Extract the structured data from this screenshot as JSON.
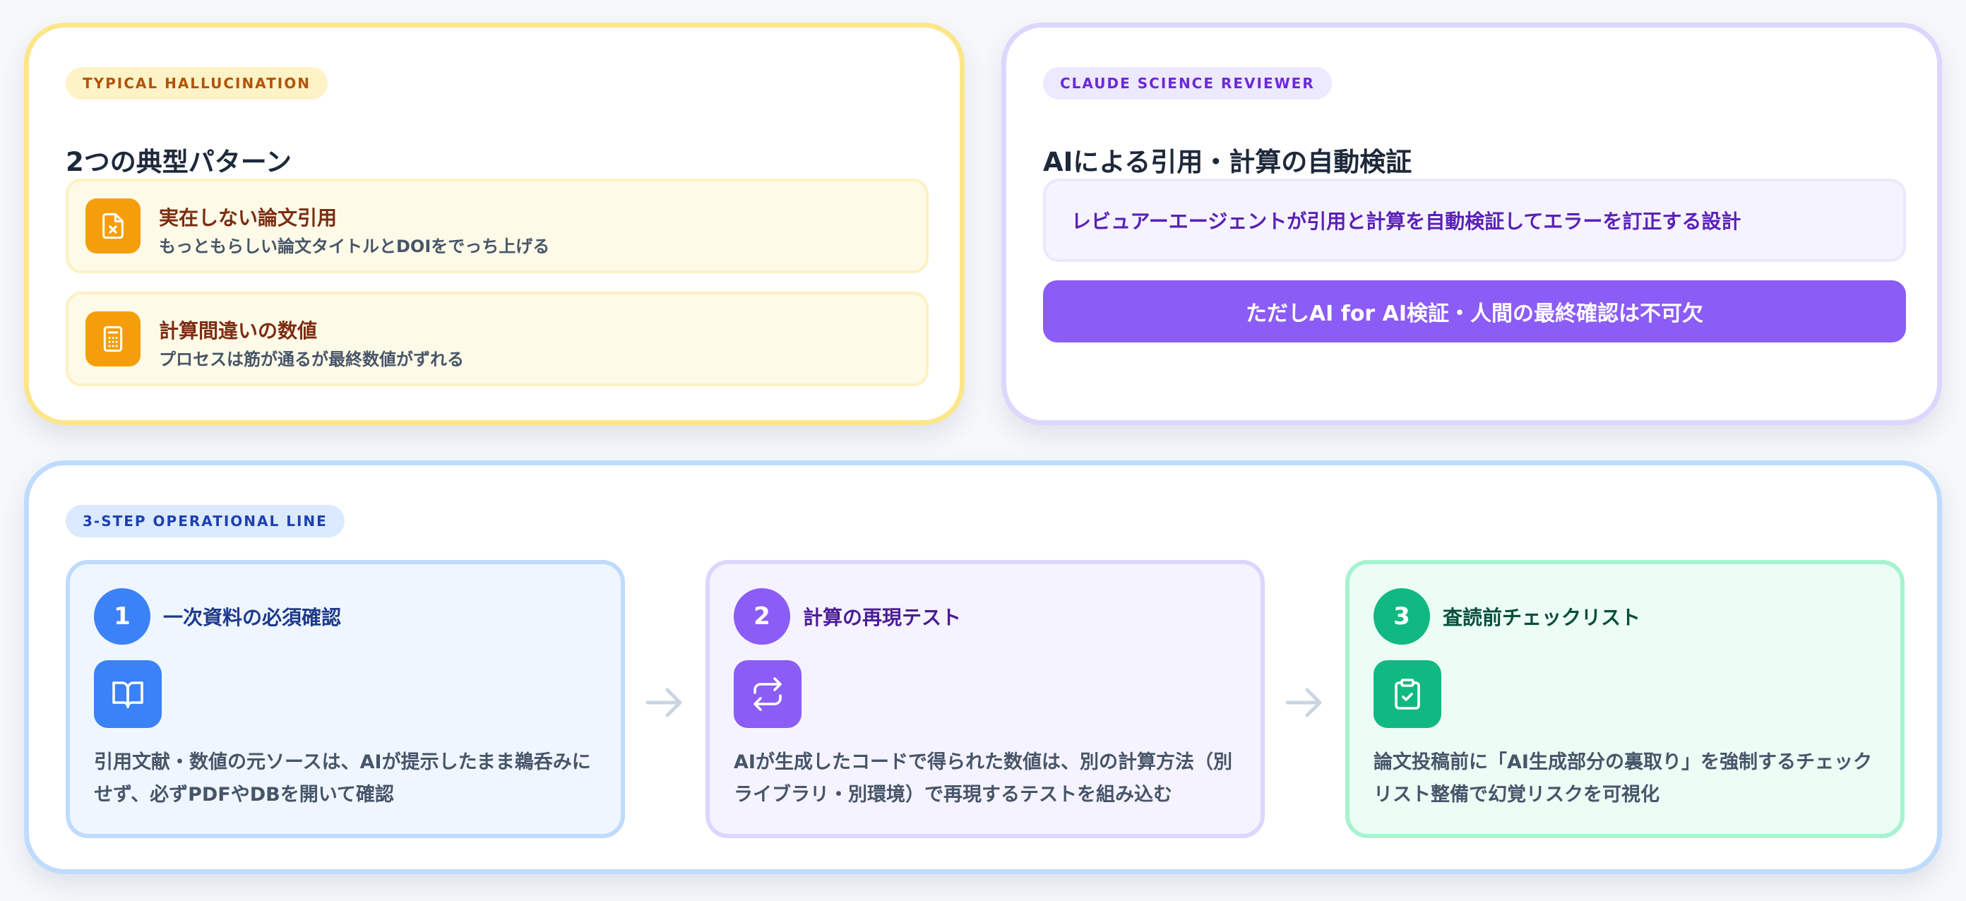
{
  "hallucination": {
    "badge": "TYPICAL HALLUCINATION",
    "title": "2つの典型パターン",
    "patterns": [
      {
        "title": "実在しない論文引用",
        "description": "もっともらしい論文タイトルとDOIをでっち上げる",
        "icon": "file-x-icon"
      },
      {
        "title": "計算間違いの数値",
        "description": "プロセスは筋が通るが最終数値がずれる",
        "icon": "calculator-icon"
      }
    ]
  },
  "reviewer": {
    "badge": "CLAUDE SCIENCE REVIEWER",
    "title": "AIによる引用・計算の自動検証",
    "description": "レビュアーエージェントが引用と計算を自動検証してエラーを訂正する設計",
    "button_label": "ただしAI for AI検証・人間の最終確認は不可欠"
  },
  "operational_line": {
    "badge": "3-STEP OPERATIONAL LINE",
    "steps": [
      {
        "number": "1",
        "title": "一次資料の必須確認",
        "description": "引用文献・数値の元ソースは、AIが提示したまま鵜呑みにせず、必ずPDFやDBを開いて確認",
        "icon": "book-open-icon"
      },
      {
        "number": "2",
        "title": "計算の再現テスト",
        "description": "AIが生成したコードで得られた数値は、別の計算方法（別ライブラリ・別環境）で再現するテストを組み込む",
        "icon": "repeat-icon"
      },
      {
        "number": "3",
        "title": "査読前チェックリスト",
        "description": "論文投稿前に「AI生成部分の裏取り」を強制するチェックリスト整備で幻覚リスクを可視化",
        "icon": "clipboard-check-icon"
      }
    ]
  },
  "colors": {
    "yellow_accent": "#f59e0b",
    "purple_accent": "#8b5cf6",
    "blue_accent": "#3b82f6",
    "green_accent": "#10b981"
  }
}
